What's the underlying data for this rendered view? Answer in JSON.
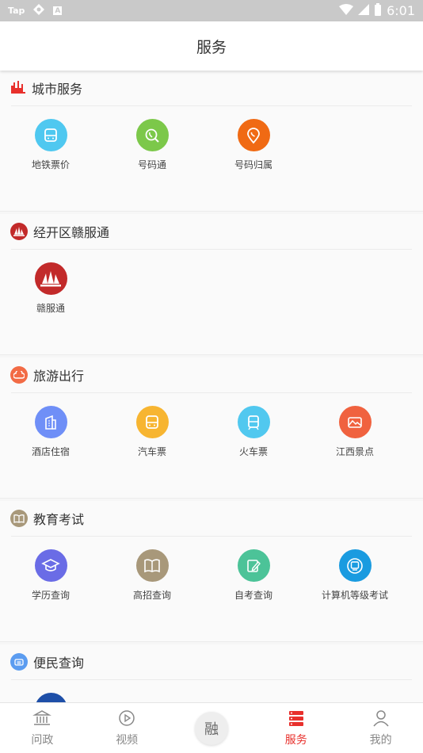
{
  "status_bar": {
    "app_label": "Tap",
    "box_label": "A",
    "time": "6:01"
  },
  "header": {
    "title": "服务"
  },
  "sections": [
    {
      "title": "城市服务",
      "icon": "city-icon",
      "color": "#e8302c",
      "items": [
        {
          "label": "地铁票价",
          "icon": "bus-icon",
          "color": "#4fc8f0"
        },
        {
          "label": "号码通",
          "icon": "phone-search-icon",
          "color": "#7cc84a"
        },
        {
          "label": "号码归属",
          "icon": "location-pin-icon",
          "color": "#f06a14"
        }
      ]
    },
    {
      "title": "经开区赣服通",
      "icon": "ganfutong-logo-icon",
      "color": "#c22a2a",
      "items": [
        {
          "label": "赣服通",
          "icon": "ganfutong-logo-icon",
          "color": "#c22a2a"
        }
      ]
    },
    {
      "title": "旅游出行",
      "icon": "cloud-icon",
      "color": "#f26b45",
      "items": [
        {
          "label": "酒店住宿",
          "icon": "building-icon",
          "color": "#6f8ff7"
        },
        {
          "label": "汽车票",
          "icon": "bus-icon",
          "color": "#f7b531"
        },
        {
          "label": "火车票",
          "icon": "train-icon",
          "color": "#51c8ef"
        },
        {
          "label": "江西景点",
          "icon": "landscape-icon",
          "color": "#f0623f"
        }
      ]
    },
    {
      "title": "教育考试",
      "icon": "book-icon",
      "color": "#a8987a",
      "items": [
        {
          "label": "学历查询",
          "icon": "graduation-cap-icon",
          "color": "#6a6ce6"
        },
        {
          "label": "高招查询",
          "icon": "book-icon",
          "color": "#a8987a"
        },
        {
          "label": "自考查询",
          "icon": "edit-icon",
          "color": "#4cc398"
        },
        {
          "label": "计算机等级考试",
          "icon": "computer-icon",
          "color": "#1a9be0"
        }
      ]
    },
    {
      "title": "便民查询",
      "icon": "printer-icon",
      "color": "#5b9cf0",
      "items": [
        {
          "label": "",
          "icon": "query-icon",
          "color": "#1e4fa8"
        }
      ]
    }
  ],
  "bottom_nav": [
    {
      "label": "问政",
      "icon": "government-icon",
      "active": false
    },
    {
      "label": "视频",
      "icon": "play-icon",
      "active": false
    },
    {
      "label": "融",
      "icon": "rong-center-icon",
      "active": false
    },
    {
      "label": "服务",
      "icon": "list-icon",
      "active": true
    },
    {
      "label": "我的",
      "icon": "user-icon",
      "active": false
    }
  ],
  "colors": {
    "accent": "#e8302c",
    "inactive": "#888888"
  }
}
